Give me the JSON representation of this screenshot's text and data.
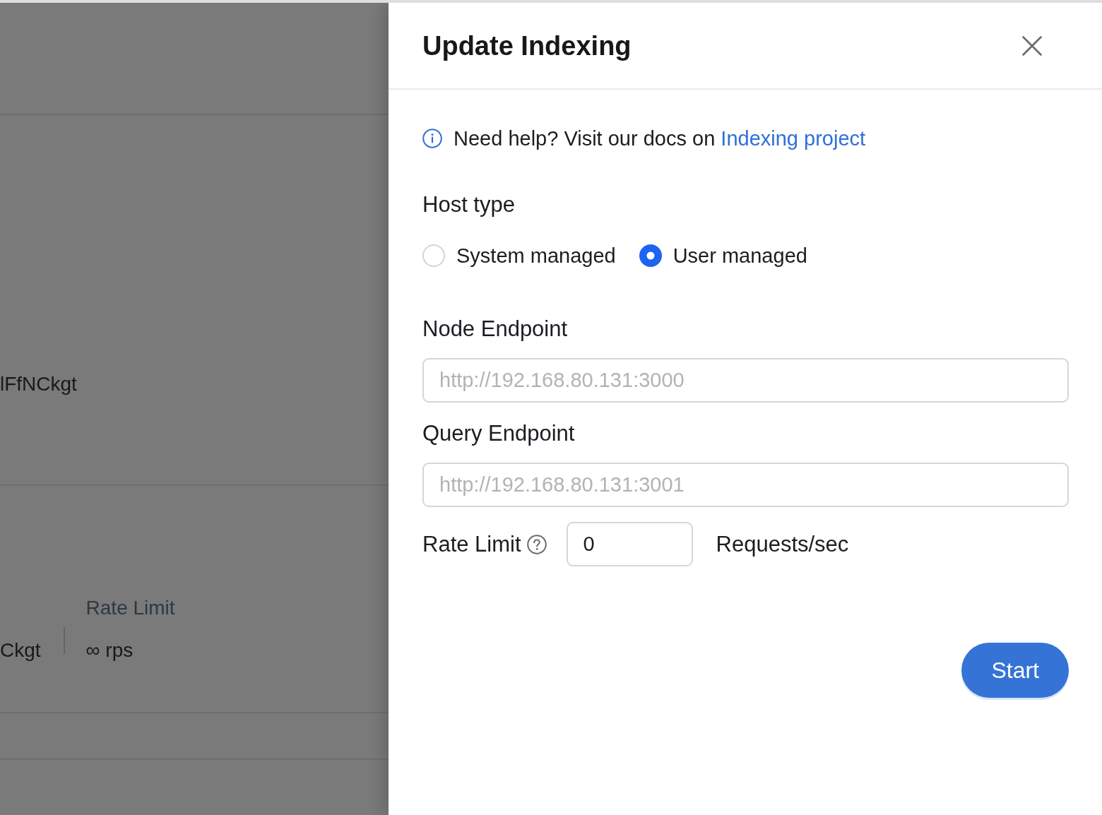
{
  "background_page": {
    "row_1_value": "lFfNCkgt",
    "row_2": {
      "column_1_value": "Ckgt",
      "rate_limit": {
        "label": "Rate Limit",
        "value": "∞ rps"
      }
    }
  },
  "drawer": {
    "title": "Update Indexing",
    "help": {
      "text": "Need help? Visit our docs on",
      "link": "Indexing project"
    },
    "host_type": {
      "label": "Host type",
      "options": [
        {
          "label": "System managed",
          "selected": false
        },
        {
          "label": "User managed",
          "selected": true
        }
      ]
    },
    "fields": [
      {
        "label": "Node Endpoint",
        "placeholder": "http://192.168.80.131:3000"
      },
      {
        "label": "Query Endpoint",
        "placeholder": "http://192.168.80.131:3001"
      }
    ],
    "rate_limit": {
      "label": "Rate Limit",
      "value": "0",
      "unit": "Requests/sec"
    },
    "buttons": [
      {
        "label": "Start",
        "kind": "primary"
      }
    ]
  }
}
